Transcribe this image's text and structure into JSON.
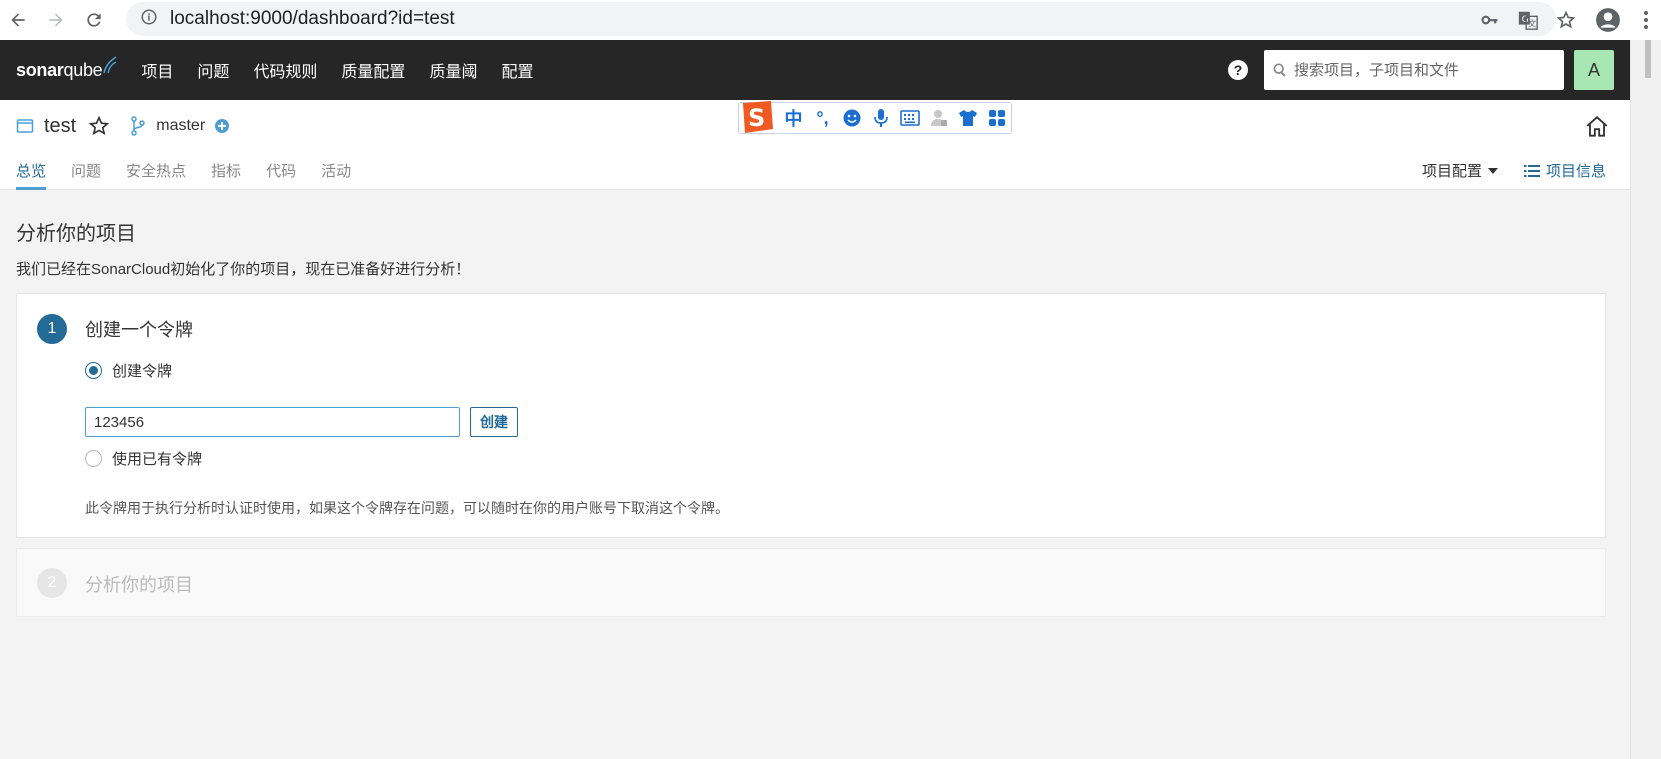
{
  "browser": {
    "url": "localhost:9000/dashboard?id=test",
    "icons": [
      "back-icon",
      "forward-icon",
      "reload-icon",
      "info-icon",
      "key-icon",
      "translate-icon",
      "star-icon",
      "account-icon",
      "menu-icon"
    ]
  },
  "navbar": {
    "logo_bold": "sonar",
    "logo_light": "qube",
    "menu": [
      "项目",
      "问题",
      "代码规则",
      "质量配置",
      "质量阈",
      "配置"
    ],
    "help": "?",
    "search_placeholder": "搜索项目，子项目和文件",
    "avatar_letter": "A",
    "avatar_color": "#a8e6b4"
  },
  "project": {
    "name": "test",
    "branch": "master",
    "tabs": [
      "总览",
      "问题",
      "安全热点",
      "指标",
      "代码",
      "活动"
    ],
    "active_tab": "总览",
    "config_label": "项目配置",
    "info_label": "项目信息"
  },
  "ime": {
    "buttons": [
      "中",
      "°,",
      "emoji-icon",
      "mic-icon",
      "keyboard-icon",
      "user-icon",
      "shirt-icon",
      "apps-icon"
    ]
  },
  "main": {
    "title": "分析你的项目",
    "description": "我们已经在SonarCloud初始化了你的项目，现在已准备好进行分析！",
    "step1": {
      "number": "1",
      "title": "创建一个令牌",
      "option_create": "创建令牌",
      "token_value": "123456",
      "create_button": "创建",
      "option_existing": "使用已有令牌",
      "note": "此令牌用于执行分析时认证时使用，如果这个令牌存在问题，可以随时在你的用户账号下取消这个令牌。"
    },
    "step2": {
      "number": "2",
      "title": "分析你的项目"
    }
  },
  "colors": {
    "accent": "#236a97",
    "navbar": "#262626"
  }
}
